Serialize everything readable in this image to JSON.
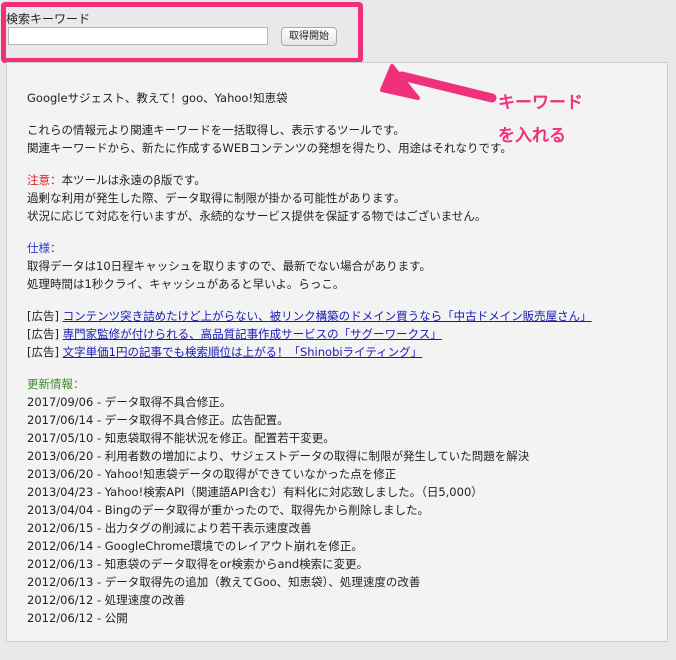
{
  "search": {
    "label": "検索キーワード",
    "input_value": "",
    "button_label": "取得開始"
  },
  "annotation": {
    "line1": "キーワード",
    "line2": "を入れる",
    "color": "#f0307a"
  },
  "intro": {
    "title": "Googleサジェスト、教えて！goo、Yahoo!知恵袋",
    "lines": [
      "これらの情報元より関連キーワードを一括取得し、表示するツールです。",
      "関連キーワードから、新たに作成するWEBコンテンツの発想を得たり、用途はそれなりです。"
    ]
  },
  "notice": {
    "heading": "注意：",
    "lines": [
      "本ツールは永遠のβ版です。",
      "過剰な利用が発生した際、データ取得に制限が掛かる可能性があります。",
      "状況に応じて対応を行いますが、永続的なサービス提供を保証する物ではございません。"
    ]
  },
  "spec": {
    "heading": "仕様：",
    "lines": [
      "取得データは10日程キャッシュを取りますので、最新でない場合があります。",
      "処理時間は1秒クライ、キャッシュがあると早いよ。らっこ。"
    ]
  },
  "ads": [
    {
      "prefix": "[広告]",
      "text": "コンテンツ突き詰めたけど上がらない、被リンク構築のドメイン買うなら「中古ドメイン販売屋さん」"
    },
    {
      "prefix": "[広告]",
      "text": "専門家監修が付けられる、高品質記事作成サービスの「サグーワークス」"
    },
    {
      "prefix": "[広告]",
      "text": "文字単価1円の記事でも検索順位は上がる！「Shinobiライティング」"
    }
  ],
  "updates": {
    "heading": "更新情報：",
    "items": [
      "2017/09/06 - データ取得不具合修正。",
      "2017/06/14 - データ取得不具合修正。広告配置。",
      "2017/05/10 - 知恵袋取得不能状況を修正。配置若干変更。",
      "2013/06/20 - 利用者数の増加により、サジェストデータの取得に制限が発生していた問題を解決",
      "2013/06/20 - Yahoo!知恵袋データの取得ができていなかった点を修正",
      "2013/04/23 - Yahoo!検索API（関連語API含む）有料化に対応致しました。（日5,000）",
      "2013/04/04 - Bingのデータ取得が重かったので、取得先から削除しました。",
      "2012/06/15 - 出力タグの削減により若干表示速度改善",
      "2012/06/14 - GoogleChrome環境でのレイアウト崩れを修正。",
      "2012/06/13 - 知恵袋のデータ取得をor検索からand検索に変更。",
      "2012/06/13 - データ取得先の追加（教えてGoo、知恵袋）、処理速度の改善",
      "2012/06/12 - 処理速度の改善",
      "2012/06/12 - 公開"
    ]
  }
}
